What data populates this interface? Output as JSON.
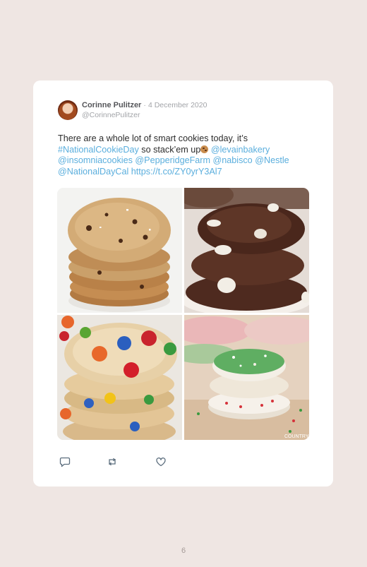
{
  "tweet": {
    "author_name": "Corinne Pulitzer",
    "separator": "·",
    "date": "4 December 2020",
    "handle": "@CorinnePulitzer",
    "text_1": "There are a whole lot of smart cookies today, it’s ",
    "hashtag": "#NationalCookieDay",
    "text_2": " so stack’em up",
    "mentions": [
      "@levainbakery",
      "@insomniacookies",
      "@PepperidgeFarm",
      "@nabisco",
      "@Nestle",
      "@NationalDayCal"
    ],
    "url": "https://t.co/ZY0yrY3Al7",
    "images": [
      {
        "name": "chocolate-chip-cookie-stack-photo"
      },
      {
        "name": "double-chocolate-cookie-stack-photo"
      },
      {
        "name": "mm-cookie-stack-photo"
      },
      {
        "name": "sprinkle-sugar-cookie-stack-photo",
        "watermark": "COUNTRY"
      }
    ]
  },
  "actions": {
    "reply_icon": "reply-icon",
    "retweet_icon": "retweet-icon",
    "like_icon": "heart-icon"
  },
  "colors": {
    "background": "#efe6e3",
    "card": "#ffffff",
    "link": "#5aaedd",
    "muted": "#a2a4a8"
  },
  "page_number": "6"
}
